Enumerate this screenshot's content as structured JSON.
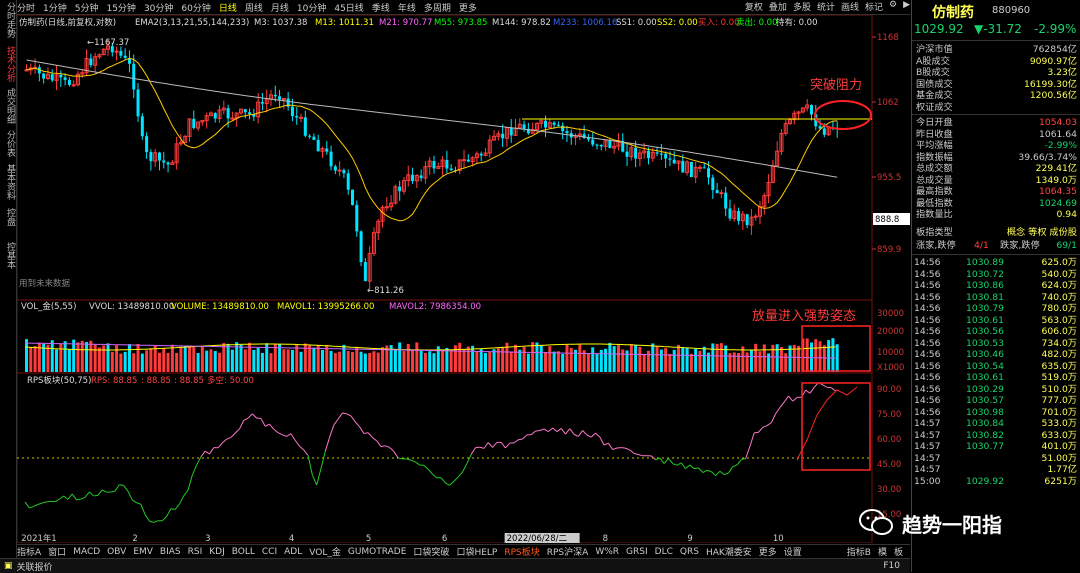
{
  "left_tabs": [
    {
      "label": "分时走势",
      "active": false
    },
    {
      "label": "技术分析",
      "active": true
    },
    {
      "label": "成交明细",
      "active": false
    },
    {
      "label": "分价表",
      "active": false
    },
    {
      "label": "基本资料",
      "active": false
    },
    {
      "label": "控盘",
      "active": false
    },
    {
      "label": "控基本",
      "active": false
    }
  ],
  "toolbar": {
    "periods": [
      "分时",
      "1分钟",
      "5分钟",
      "15分钟",
      "30分钟",
      "60分钟",
      "日线",
      "周线",
      "月线",
      "10分钟",
      "45日线",
      "季线",
      "年线",
      "多周期",
      "更多"
    ],
    "active_period": "日线",
    "right_items": [
      "复权",
      "叠加",
      "多股",
      "统计",
      "画线",
      "标记",
      "⚙",
      "▶"
    ]
  },
  "main_panel": {
    "stock_label": "仿制药(日线,前复权,对数)",
    "ema_label": "EMA2(3,13,21,55,144,233)",
    "indicators": [
      {
        "text": "M3: 1037.38",
        "color": "#dddddd"
      },
      {
        "text": "M13: 1011.31",
        "color": "#ffff00"
      },
      {
        "text": "M21: 970.77",
        "color": "#ff66ff"
      },
      {
        "text": "M55: 973.85",
        "color": "#00ff00"
      },
      {
        "text": "M144: 978.82",
        "color": "#dddddd"
      },
      {
        "text": "M233: 1006.16",
        "color": "#3366ff"
      },
      {
        "text": "SS1: 0.00",
        "color": "#dddddd"
      },
      {
        "text": "SS2: 0.00",
        "color": "#ffff00"
      },
      {
        "text": "买入: 0.00",
        "color": "#ff3333"
      },
      {
        "text": "卖出: 0.00",
        "color": "#00ff00"
      },
      {
        "text": "持有: 0.00",
        "color": "#dddddd"
      }
    ],
    "y_ticks": [
      "1168",
      "1062",
      "955.5",
      "859.9"
    ],
    "current_price_label": "888.8",
    "high_label": "1167.37",
    "low_label": "811.26",
    "future_note": "用到未来数据",
    "annotation": "突破阻力"
  },
  "vol_panel": {
    "label": "VOL_金(5,55)",
    "indicators": [
      {
        "text": "VVOL: 13489810.00",
        "color": "#dddddd"
      },
      {
        "text": "VOLUME: 13489810.00",
        "color": "#ffff00"
      },
      {
        "text": "MAVOL1: 13995266.00",
        "color": "#ffff00"
      },
      {
        "text": "MAVOL2: 7986354.00",
        "color": "#ff66ff"
      }
    ],
    "y_ticks": [
      "30000",
      "20000",
      "10000",
      "X1000"
    ],
    "annotation": "放量进入强势姿态"
  },
  "rps_panel": {
    "label": "RPS板块(50,75)",
    "indicators": [
      {
        "text": "RPS: 88.85",
        "color": "#ff4444"
      },
      {
        "text": ": 88.85",
        "color": "#ff4444"
      },
      {
        "text": ": 88.85",
        "color": "#ff4444"
      },
      {
        "text": "多空: 50.00",
        "color": "#ff4444"
      }
    ],
    "y_ticks": [
      "90.00",
      "75.00",
      "60.00",
      "45.00",
      "30.00",
      "15.00"
    ]
  },
  "x_labels": [
    {
      "text": "2021年",
      "pos": 0.005
    },
    {
      "text": "1",
      "pos": 0.04
    },
    {
      "text": "2",
      "pos": 0.135
    },
    {
      "text": "3",
      "pos": 0.22
    },
    {
      "text": "4",
      "pos": 0.318
    },
    {
      "text": "5",
      "pos": 0.408
    },
    {
      "text": "6",
      "pos": 0.497
    },
    {
      "text": "2022/06/28/二",
      "pos": 0.575
    },
    {
      "text": "8",
      "pos": 0.685
    },
    {
      "text": "9",
      "pos": 0.784
    },
    {
      "text": "10",
      "pos": 0.884
    }
  ],
  "indicator_tabs": {
    "items": [
      "指标A",
      "窗口",
      "MACD",
      "OBV",
      "EMV",
      "BIAS",
      "RSI",
      "KDJ",
      "BOLL",
      "CCI",
      "ADL",
      "VOL_金",
      "GUMOTRADE",
      "口袋突破",
      "口袋HELP",
      "RPS板块",
      "RPS沪深A",
      "W%R",
      "GRSI",
      "DLC",
      "QRS",
      "HAK潮委安",
      "更多",
      "设置"
    ],
    "active": "RPS板块",
    "right_items": [
      "指标B",
      "模",
      "板"
    ]
  },
  "status_bar": {
    "text": "关联报价",
    "right": "F10"
  },
  "right_panel": {
    "name": "仿制药",
    "code": "880960",
    "price": "1029.92",
    "change": "▼-31.72",
    "change_pct": "-2.99%",
    "stats": [
      {
        "k": "沪深市值",
        "v": "762854亿",
        "c": "#cccccc"
      },
      {
        "k": "A股成交",
        "v": "9090.97亿",
        "c": "#ffff55"
      },
      {
        "k": "B股成交",
        "v": "3.23亿",
        "c": "#ffff55"
      },
      {
        "k": "国债成交",
        "v": "16199.30亿",
        "c": "#ffff55"
      },
      {
        "k": "基金成交",
        "v": "1200.56亿",
        "c": "#ffff55"
      },
      {
        "k": "权证成交",
        "v": "",
        "c": "#ffff55"
      },
      {
        "k": "今日开盘",
        "v": "1054.03",
        "c": "#ff4444"
      },
      {
        "k": "昨日收盘",
        "v": "1061.64",
        "c": "#cccccc"
      },
      {
        "k": "平均涨幅",
        "v": "-2.99%",
        "c": "#19d36a"
      },
      {
        "k": "指数振幅",
        "v": "39.66/3.74%",
        "c": "#cccccc"
      },
      {
        "k": "总成交额",
        "v": "229.41亿",
        "c": "#ffff55"
      },
      {
        "k": "总成交量",
        "v": "1349.0万",
        "c": "#ffff55"
      },
      {
        "k": "最高指数",
        "v": "1064.35",
        "c": "#ff4444"
      },
      {
        "k": "最低指数",
        "v": "1024.69",
        "c": "#19d36a"
      },
      {
        "k": "指数量比",
        "v": "0.94",
        "c": "#ffff55"
      }
    ],
    "board_type": {
      "k": "板指类型",
      "v": "概念 等权 成份股"
    },
    "updown": {
      "k1": "涨家,跌停",
      "v1": "4/1",
      "k2": "跌家,跌停",
      "v2": "69/1"
    },
    "ticks": [
      {
        "t": "14:56",
        "p": "1030.89",
        "q": "625.0万"
      },
      {
        "t": "14:56",
        "p": "1030.72",
        "q": "540.0万"
      },
      {
        "t": "14:56",
        "p": "1030.86",
        "q": "624.0万"
      },
      {
        "t": "14:56",
        "p": "1030.81",
        "q": "740.0万"
      },
      {
        "t": "14:56",
        "p": "1030.79",
        "q": "780.0万"
      },
      {
        "t": "14:56",
        "p": "1030.61",
        "q": "563.0万"
      },
      {
        "t": "14:56",
        "p": "1030.56",
        "q": "606.0万"
      },
      {
        "t": "14:56",
        "p": "1030.53",
        "q": "734.0万"
      },
      {
        "t": "14:56",
        "p": "1030.46",
        "q": "482.0万"
      },
      {
        "t": "14:56",
        "p": "1030.54",
        "q": "635.0万"
      },
      {
        "t": "14:56",
        "p": "1030.61",
        "q": "519.0万"
      },
      {
        "t": "14:56",
        "p": "1030.29",
        "q": "510.0万"
      },
      {
        "t": "14:56",
        "p": "1030.57",
        "q": "777.0万"
      },
      {
        "t": "14:56",
        "p": "1030.98",
        "q": "701.0万"
      },
      {
        "t": "14:57",
        "p": "1030.84",
        "q": "533.0万"
      },
      {
        "t": "14:57",
        "p": "1030.82",
        "q": "633.0万"
      },
      {
        "t": "14:57",
        "p": "1030.77",
        "q": "401.0万"
      },
      {
        "t": "14:57",
        "p": "",
        "q": "51.00万"
      },
      {
        "t": "14:57",
        "p": "",
        "q": "1.77亿"
      },
      {
        "t": "15:00",
        "p": "1029.92",
        "q": "6251万"
      }
    ]
  },
  "watermark": {
    "text": "趋势一阳指"
  }
}
